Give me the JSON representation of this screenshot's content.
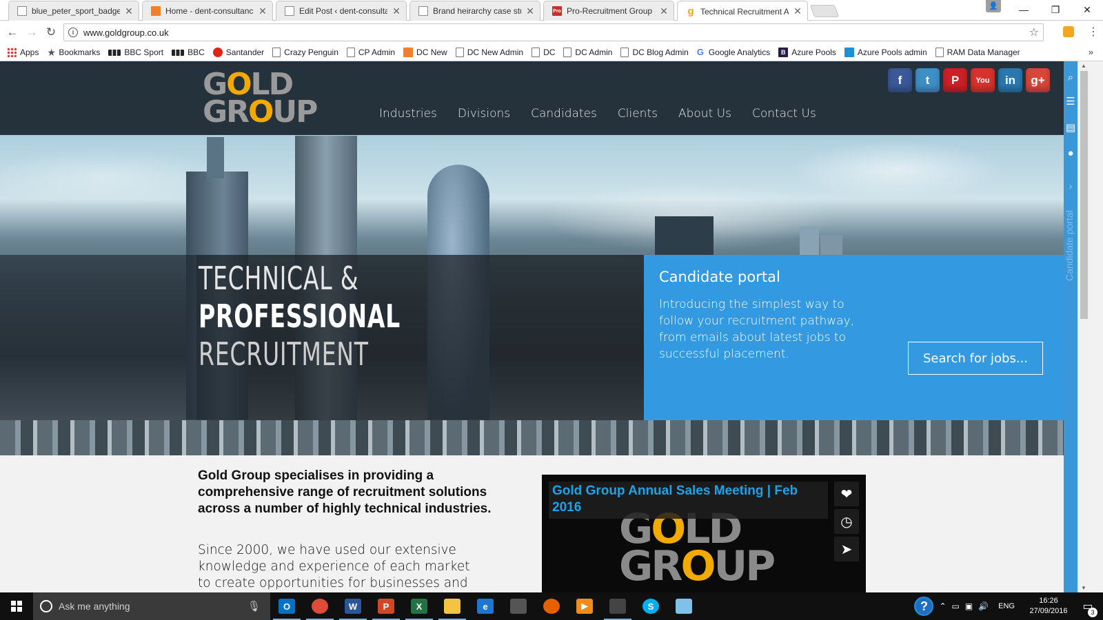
{
  "browser": {
    "tabs": [
      {
        "title": "blue_peter_sport_badge_",
        "favicon": "page"
      },
      {
        "title": "Home - dent-consultanc",
        "favicon": "orange"
      },
      {
        "title": "Edit Post ‹ dent-consulta",
        "favicon": "page"
      },
      {
        "title": "Brand heirarchy case stu",
        "favicon": "page"
      },
      {
        "title": "Pro-Recruitment Group -",
        "favicon": "pro"
      },
      {
        "title": "Technical Recruitment A",
        "favicon": "gold"
      }
    ],
    "pro_favicon_label": "Pro",
    "gold_favicon_label": "g",
    "url": "www.goldgroup.co.uk",
    "bookmarks": [
      "Apps",
      "Bookmarks",
      "BBC Sport",
      "BBC",
      "Santander",
      "Crazy Penguin",
      "CP Admin",
      "DC New",
      "DC New Admin",
      "DC",
      "DC Admin",
      "DC Blog Admin",
      "Google Analytics",
      "Azure Pools",
      "Azure Pools admin",
      "RAM Data Manager"
    ],
    "bookmark_icons": [
      "apps",
      "star",
      "bbc",
      "bbc",
      "santander",
      "page",
      "page",
      "orange",
      "page",
      "page",
      "page",
      "page",
      "google",
      "bpurple",
      "azure",
      "page"
    ],
    "google_icon_letter": "G",
    "azure_pools_icon_letter": "B"
  },
  "site": {
    "logo_line1_a": "G",
    "logo_line1_gold": "O",
    "logo_line1_b": "LD",
    "logo_line2_a": "GR",
    "logo_line2_gold": "O",
    "logo_line2_b": "UP",
    "nav": [
      "Industries",
      "Divisions",
      "Candidates",
      "Clients",
      "About Us",
      "Contact Us"
    ],
    "socials": [
      {
        "name": "facebook",
        "glyph": "f",
        "color": "#3b5998"
      },
      {
        "name": "twitter",
        "glyph": "t",
        "color": "#3f8fc7"
      },
      {
        "name": "pinterest",
        "glyph": "P",
        "color": "#cb2027"
      },
      {
        "name": "youtube",
        "glyph": "You",
        "color": "#d8322c"
      },
      {
        "name": "linkedin",
        "glyph": "in",
        "color": "#2b78b0"
      },
      {
        "name": "googleplus",
        "glyph": "g+",
        "color": "#d8463a"
      }
    ],
    "hero": {
      "line1": "TECHNICAL &",
      "line2": "PROFESSIONAL",
      "line3": "RECRUITMENT"
    },
    "portal": {
      "title": "Candidate portal",
      "text": "Introducing the simplest way to follow your recruitment pathway, from emails about latest jobs to successful placement.",
      "button": "Search for jobs..."
    },
    "lead": "Gold Group specialises in providing a comprehensive range of recruitment solutions across a number of highly technical industries.",
    "body": "Since 2000, we have used our extensive knowledge and experience of each market to create opportunities for businesses and",
    "video": {
      "title": "Gold Group Annual Sales Meeting | Feb 2016"
    },
    "side_panel_label": "Candidate portal",
    "brand_gold": "#f2a900",
    "portal_blue": "#3399e0"
  },
  "taskbar": {
    "search_placeholder": "Ask me anything",
    "apps": [
      {
        "name": "outlook",
        "glyph": "O",
        "color": "#0072c6",
        "running": true
      },
      {
        "name": "chrome",
        "glyph": "",
        "color": "#dd4b39",
        "running": true
      },
      {
        "name": "word",
        "glyph": "W",
        "color": "#2b579a",
        "running": true
      },
      {
        "name": "powerpoint",
        "glyph": "P",
        "color": "#d24726",
        "running": true
      },
      {
        "name": "excel",
        "glyph": "X",
        "color": "#217346",
        "running": true
      },
      {
        "name": "file-explorer",
        "glyph": "",
        "color": "#f5c342",
        "running": true
      },
      {
        "name": "edge",
        "glyph": "e",
        "color": "#1e76d3",
        "running": false
      },
      {
        "name": "store",
        "glyph": "",
        "color": "#555555",
        "running": false
      },
      {
        "name": "firefox",
        "glyph": "",
        "color": "#e66000",
        "running": false
      },
      {
        "name": "media-player",
        "glyph": "▶",
        "color": "#f08b1d",
        "running": false
      },
      {
        "name": "photos",
        "glyph": "",
        "color": "#444444",
        "running": true
      },
      {
        "name": "skype",
        "glyph": "S",
        "color": "#00aff0",
        "running": false
      },
      {
        "name": "notepad",
        "glyph": "",
        "color": "#7fc1e8",
        "running": false
      }
    ],
    "help_label": "?",
    "language": "ENG",
    "time": "16:26",
    "date": "27/09/2016",
    "notification_count": "3"
  }
}
